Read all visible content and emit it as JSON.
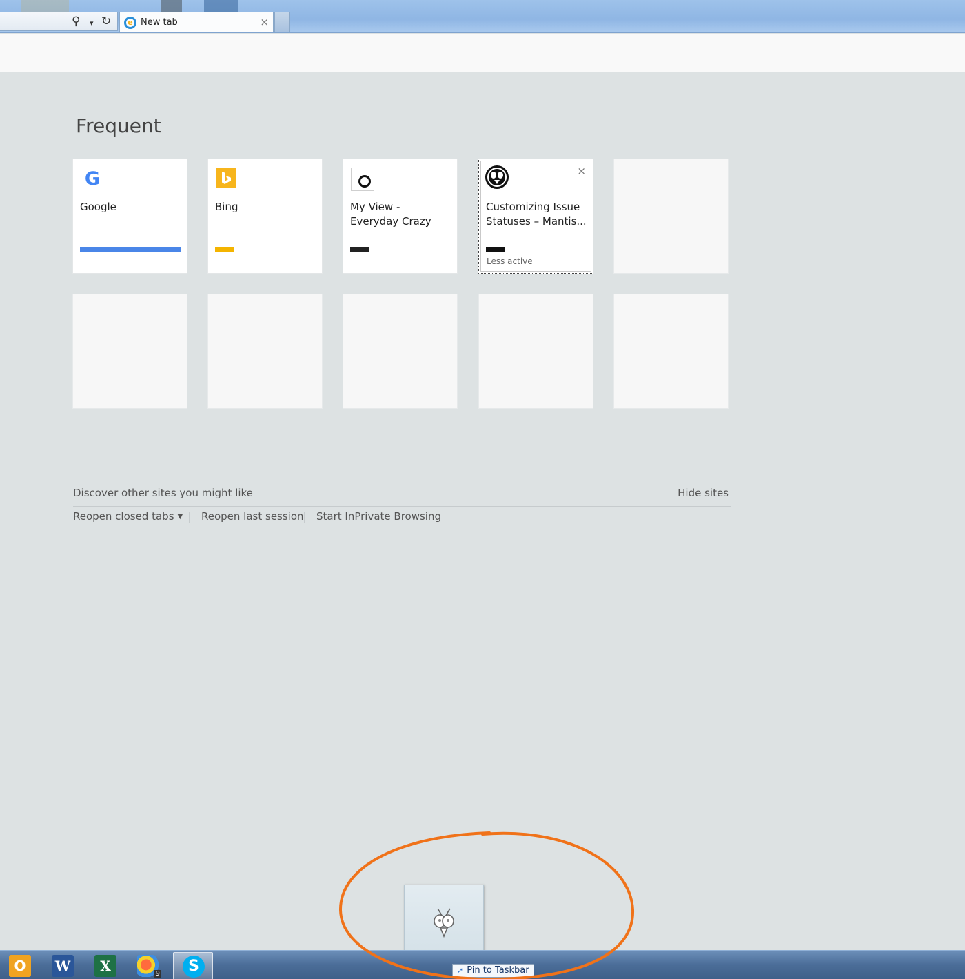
{
  "browser": {
    "tab_title": "New tab",
    "tab_close": "×",
    "search_glyph": "⚲",
    "dropdown_glyph": "▾",
    "refresh_glyph": "↻"
  },
  "page": {
    "heading": "Frequent",
    "tiles": [
      {
        "label": "Google",
        "favicon": "google-icon",
        "bar_color": "#4a86e8",
        "sub": ""
      },
      {
        "label": "Bing",
        "favicon": "bing-icon",
        "bar_color": "#f4b400",
        "sub": ""
      },
      {
        "label": "My View - Everyday Crazy",
        "favicon": "myview-icon",
        "bar_color": "#222222",
        "sub": ""
      },
      {
        "label": "Customizing Issue Statuses – Mantis...",
        "favicon": "mantis-icon",
        "bar_color": "#111111",
        "sub": "Less active",
        "remove": "×"
      }
    ],
    "discover_text": "Discover other sites you might like",
    "hide_sites": "Hide sites",
    "links": {
      "reopen_closed": "Reopen closed tabs",
      "reopen_session": "Reopen last session",
      "inprivate": "Start InPrivate Browsing"
    }
  },
  "taskbar": {
    "apps": [
      {
        "name": "outlook",
        "glyph": "O"
      },
      {
        "name": "word",
        "glyph": "W"
      },
      {
        "name": "excel",
        "glyph": "X"
      },
      {
        "name": "paint",
        "glyph": ""
      },
      {
        "name": "skype",
        "glyph": "S"
      }
    ],
    "paint_badge": "9",
    "pin_tooltip": "Pin to Taskbar"
  },
  "colors": {
    "annotation": "#f07219",
    "page_bg": "#dde2e3"
  }
}
